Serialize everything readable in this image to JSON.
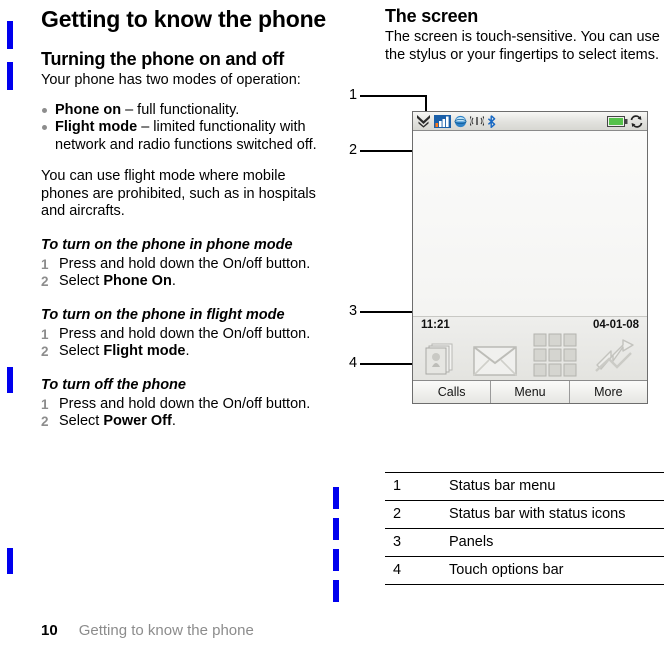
{
  "left_column": {
    "chapter_title": "Getting to know the phone",
    "section_title": "Turning the phone on and off",
    "intro": "Your phone has two modes of operation:",
    "bullets": [
      {
        "term": "Phone on",
        "rest": " – full functionality."
      },
      {
        "term": "Flight mode",
        "rest": " – limited functionality with network and radio functions switched off."
      }
    ],
    "note": "You can use flight mode where mobile phones are prohibited, such as in hospitals and aircrafts.",
    "procedures": [
      {
        "heading": "To turn on the phone in phone mode",
        "steps": [
          {
            "num": "1",
            "text": "Press and hold down the On/off button.",
            "pre": "Press and hold down the On/off button.",
            "bold": "",
            "post": ""
          },
          {
            "num": "2",
            "pre": "Select ",
            "bold": "Phone On",
            "post": "."
          }
        ]
      },
      {
        "heading": "To turn on the phone in flight mode",
        "steps": [
          {
            "num": "1",
            "pre": "Press and hold down the On/off button.",
            "bold": "",
            "post": ""
          },
          {
            "num": "2",
            "pre": "Select ",
            "bold": "Flight mode",
            "post": "."
          }
        ]
      },
      {
        "heading": "To turn off the phone",
        "steps": [
          {
            "num": "1",
            "pre": "Press and hold down the On/off button.",
            "bold": "",
            "post": ""
          },
          {
            "num": "2",
            "pre": "Select ",
            "bold": "Power Off",
            "post": "."
          }
        ]
      }
    ]
  },
  "right_column": {
    "section_title": "The screen",
    "body": "The screen is touch-sensitive. You can use the stylus or your fingertips to select items."
  },
  "figure": {
    "callouts": [
      {
        "label": "1",
        "target": "status-bar-menu-chevrons"
      },
      {
        "label": "2",
        "target": "status-bar"
      },
      {
        "label": "3",
        "target": "panels"
      },
      {
        "label": "4",
        "target": "touch-options-bar"
      }
    ],
    "phone_screen": {
      "status_icons_left": [
        "chevrons-down-icon",
        "signal-bars-icon",
        "globe-icon",
        "wifi-icon",
        "bluetooth-icon"
      ],
      "status_icons_right": [
        "battery-icon",
        "sync-icon"
      ],
      "clock": "11:21",
      "date": "04-01-08",
      "panel_icons": [
        "photos-panel-icon",
        "messaging-panel-icon",
        "grid-panel-icon",
        "shortcut-panel-icon"
      ],
      "touch_options": [
        "Calls",
        "Menu",
        "More"
      ]
    }
  },
  "legend": {
    "rows": [
      {
        "num": "1",
        "desc": "Status bar menu"
      },
      {
        "num": "2",
        "desc": "Status bar with status icons"
      },
      {
        "num": "3",
        "desc": "Panels"
      },
      {
        "num": "4",
        "desc": "Touch options bar"
      }
    ]
  },
  "footer": {
    "page_number": "10",
    "running_head": "Getting to know the phone"
  },
  "colors": {
    "change_bar": "#0000ee",
    "bullet": "#8d8d8d",
    "step_number": "#8d8d8d",
    "footer_text": "#8c8c8c"
  }
}
